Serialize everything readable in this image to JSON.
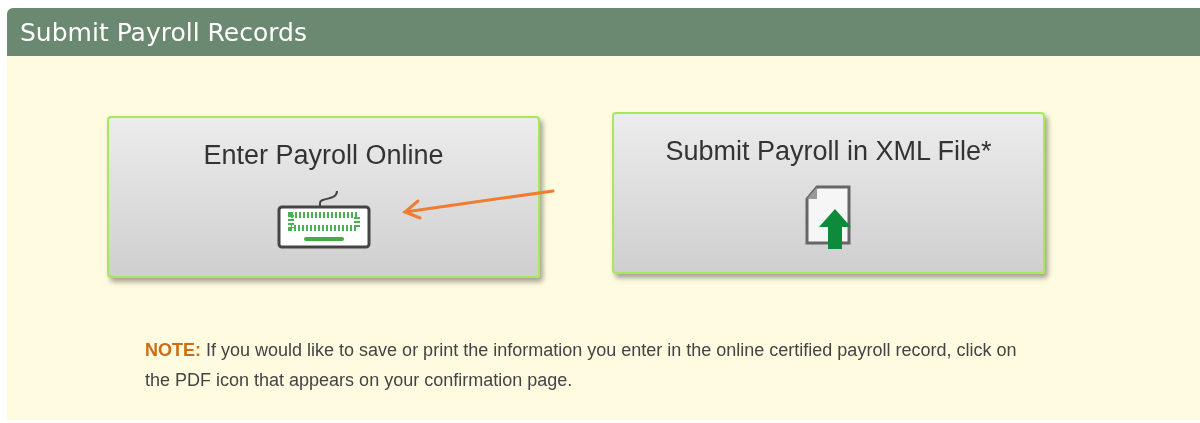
{
  "panel": {
    "title": "Submit Payroll Records"
  },
  "options": [
    {
      "label": "Enter Payroll Online",
      "kind": "keyboard"
    },
    {
      "label": "Submit Payroll in XML File*",
      "kind": "upload"
    }
  ],
  "note": {
    "label": "NOTE:",
    "text": "If you would like to save or print the information you enter in the online certified payroll record, click on the PDF icon that appears on your confirmation page."
  }
}
